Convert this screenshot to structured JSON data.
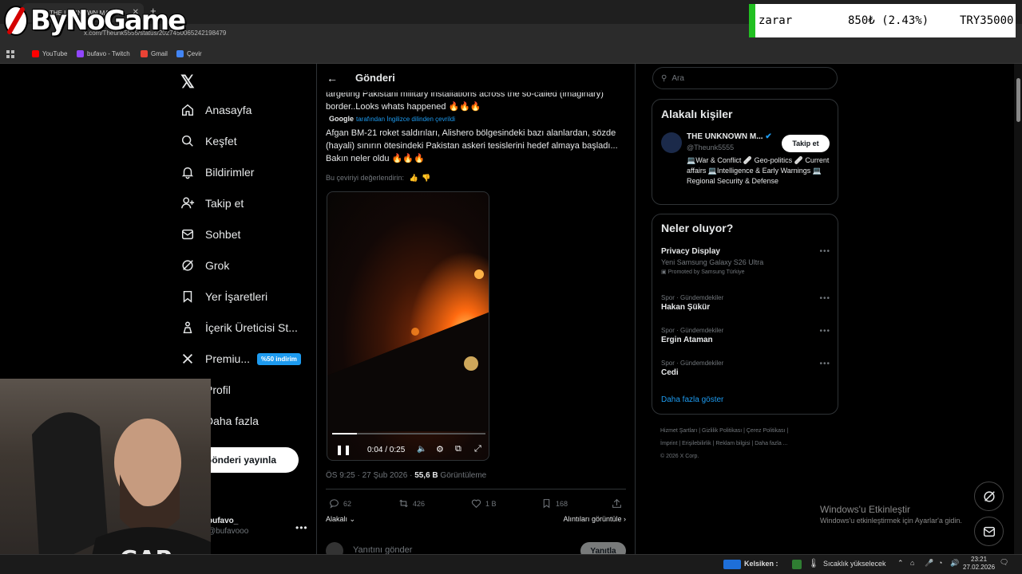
{
  "overlay": {
    "logo_text": "ByNoGame",
    "ticker": {
      "label": "zarar",
      "change": "850₺ (2.43%)",
      "total": "TRY35000"
    }
  },
  "browser": {
    "tab_title": "THE UNKNOWN MAN...",
    "address": "x.com/Theunk5555/status/2027450065242198479",
    "bookmarks": [
      "YouTube",
      "bufavo - Twitch",
      "Gmail",
      "Çevir"
    ]
  },
  "nav": {
    "items": [
      "Anasayfa",
      "Keşfet",
      "Bildirimler",
      "Takip et",
      "Sohbet",
      "Grok",
      "Yer İşaretleri",
      "İçerik Üreticisi St...",
      "Premiu...",
      "Profil",
      "Daha fazla"
    ],
    "premium_badge": "%50 indirim",
    "post_button": "Gönderi yayınla",
    "user_name": "bufavo_",
    "user_handle": "@bufavooo"
  },
  "post": {
    "header_title": "Gönderi",
    "original_text": "targeting Pakistani military installations across the so-called (imaginary) border..Looks whats happened 🔥🔥🔥",
    "translated_by_brand": "Google",
    "translated_note": "tarafından İngilizce dilinden çevrildi",
    "translated_text": "Afgan BM-21 roket saldırıları, Alishero bölgesindeki bazı alanlardan, sözde (hayali) sınırın ötesindeki Pakistan askeri tesislerini hedef almaya başladı... Bakın neler oldu 🔥🔥🔥",
    "rate_translation": "Bu çeviriyi değerlendirin:",
    "video": {
      "time": "0:04 / 0:25",
      "progress": 0.16
    },
    "timestamp": "ÖS 9:25 · 27 Şub 2026 · ",
    "views": "55,6 B",
    "views_label": " Görüntüleme",
    "stats": {
      "replies": "62",
      "reposts": "426",
      "likes": "1 B",
      "bookmarks": "168"
    },
    "sort_label": "Alakalı",
    "quotes_label": "Alıntıları görüntüle",
    "reply_placeholder": "Yanıtını gönder",
    "reply_button": "Yanıtla"
  },
  "right": {
    "search_placeholder": "Ara",
    "relevant_title": "Alakalı kişiler",
    "person": {
      "name": "THE UNKNOWN M...",
      "handle": "@Theunk5555",
      "bio": "💻War & Conflict 🩹 Geo-politics 🩹 Current affairs 💻Intelligence & Early Warnings 💻Regional Security & Defense",
      "follow_label": "Takip et"
    },
    "trends_title": "Neler oluyor?",
    "promoted": {
      "name": "Privacy Display",
      "desc": "Yeni Samsung Galaxy S26 Ultra",
      "promo": "Promoted by Samsung Türkiye"
    },
    "trends": [
      {
        "category": "Spor · Gündemdekiler",
        "name": "Hakan Şükür"
      },
      {
        "category": "Spor · Gündemdekiler",
        "name": "Ergin Ataman"
      },
      {
        "category": "Spor · Gündemdekiler",
        "name": "Cedi"
      }
    ],
    "show_more": "Daha fazla göster",
    "footer_line1": "Hizmet Şartları | Gizlilik Politikası | Çerez Politikası |",
    "footer_line2": "İmprint | Erişilebilirlik | Reklam bilgisi | Daha fazla ...",
    "footer_line3": "© 2026 X Corp."
  },
  "windows": {
    "activate_title": "Windows'u Etkinleştir",
    "activate_sub": "Windows'u etkinleştirmek için Ayarlar'a gidin.",
    "taskbar_currency": "Kelsiken :",
    "taskbar_weather": "Sıcaklık yükselecek",
    "clock_time": "23:21",
    "clock_date": "27.02.2026"
  }
}
